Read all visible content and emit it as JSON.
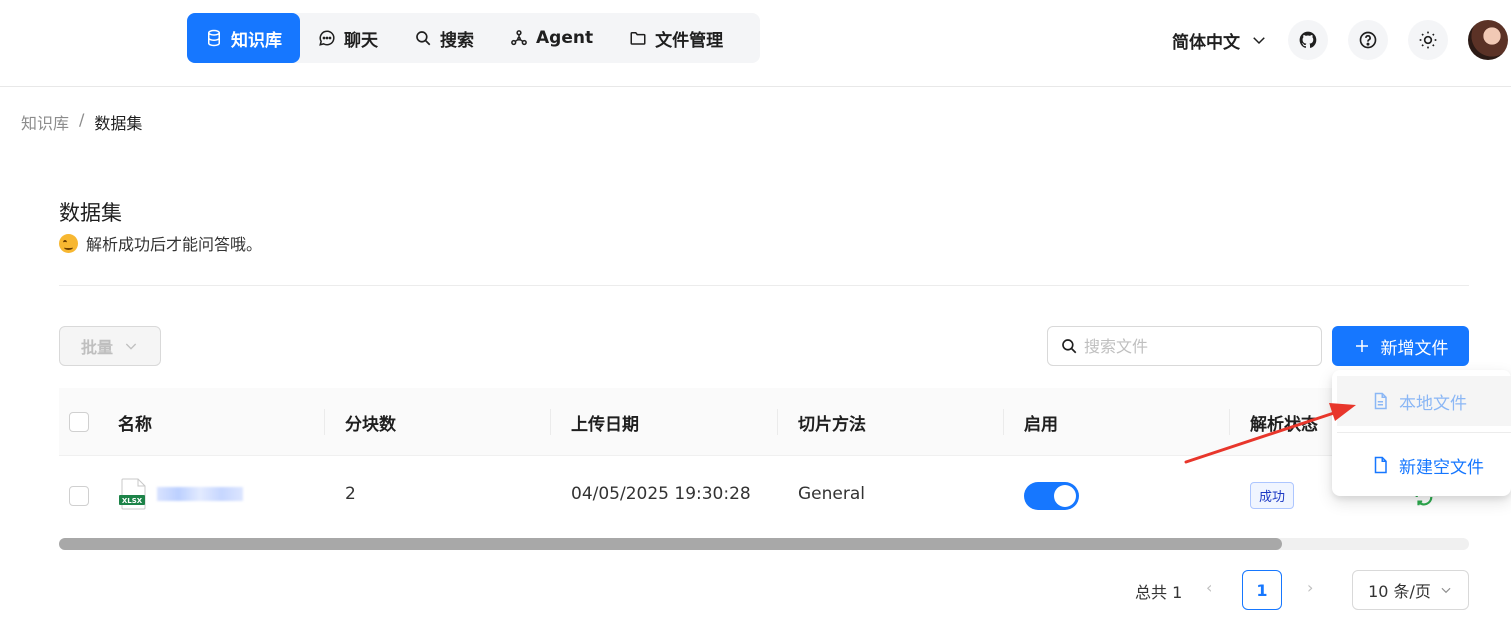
{
  "header": {
    "nav": [
      {
        "label": "知识库",
        "icon": "database-icon",
        "active": true
      },
      {
        "label": "聊天",
        "icon": "chat-icon",
        "active": false
      },
      {
        "label": "搜索",
        "icon": "search-icon",
        "active": false
      },
      {
        "label": "Agent",
        "icon": "agent-graph-icon",
        "active": false
      },
      {
        "label": "文件管理",
        "icon": "folder-icon",
        "active": false
      }
    ],
    "language": "简体中文"
  },
  "breadcrumb": {
    "root": "知识库",
    "separator": "/",
    "current": "数据集"
  },
  "page": {
    "title": "数据集",
    "subtitle": "解析成功后才能问答哦。"
  },
  "toolbar": {
    "batch_label": "批量",
    "search_placeholder": "搜索文件",
    "add_label": "新增文件"
  },
  "table": {
    "columns": [
      "名称",
      "分块数",
      "上传日期",
      "切片方法",
      "启用",
      "解析状态"
    ],
    "rows": [
      {
        "file_type": "XLSX",
        "chunks": "2",
        "upload_date": "04/05/2025 19:30:28",
        "method": "General",
        "enabled": true,
        "status": "成功"
      }
    ]
  },
  "dropdown": {
    "items": [
      "本地文件",
      "新建空文件"
    ]
  },
  "pagination": {
    "total": "总共 1",
    "current_page": "1",
    "page_size": "10 条/页"
  },
  "colors": {
    "accent": "#1677ff",
    "annotation_arrow": "#e8362b"
  }
}
